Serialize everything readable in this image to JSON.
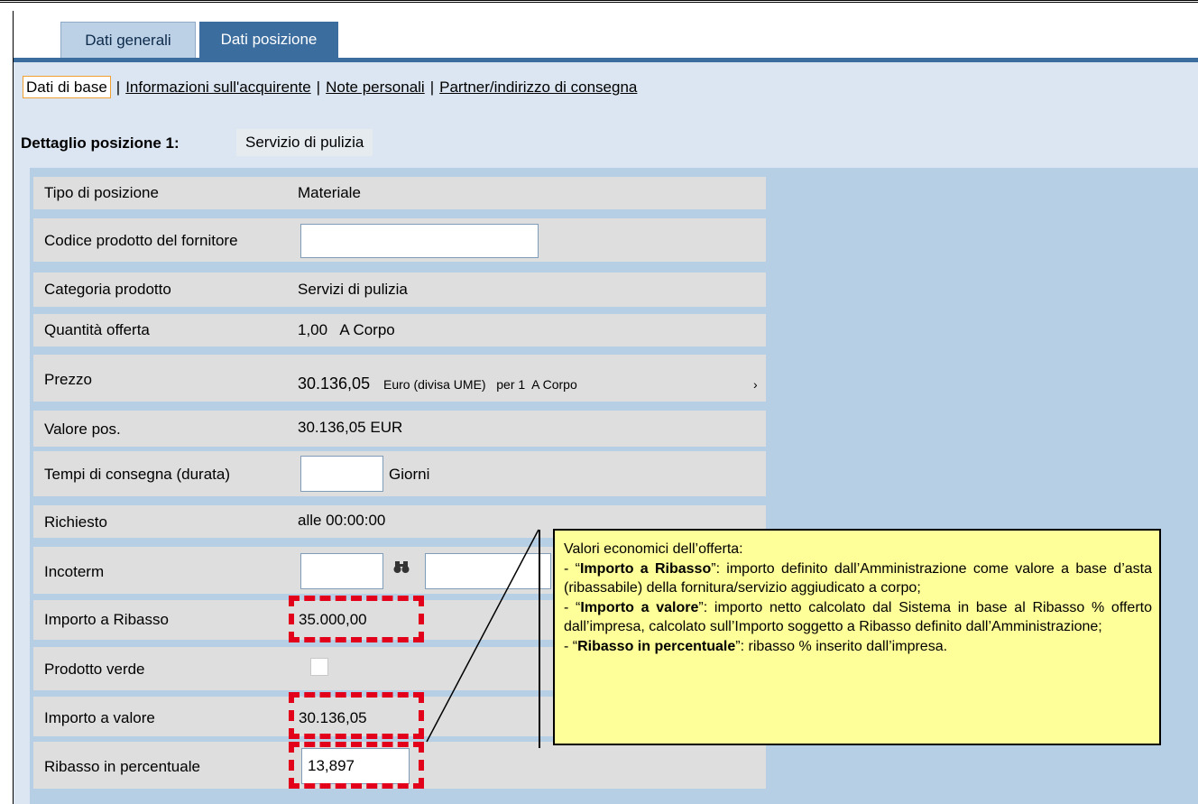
{
  "tabs": {
    "general": "Dati generali",
    "position": "Dati posizione"
  },
  "sublinks": {
    "base": "Dati di base",
    "buyer_info": "Informazioni sull'acquirente",
    "personal_notes": "Note personali",
    "partner": "Partner/indirizzo di consegna",
    "separator": "|"
  },
  "detail": {
    "label": "Dettaglio posizione 1:",
    "value": "Servizio di pulizia"
  },
  "fields": {
    "tipo_label": "Tipo di posizione",
    "tipo_value": "Materiale",
    "codice_label": "Codice prodotto del fornitore",
    "codice_value": "",
    "categoria_label": "Categoria prodotto",
    "categoria_value": "Servizi di pulizia",
    "quantita_label": "Quantità offerta",
    "quantita_value": "1,00   A Corpo",
    "prezzo_label": "Prezzo",
    "prezzo_value": "30.136,05",
    "prezzo_unit": "Euro (divisa UME)   per 1  A Corpo",
    "prezzo_arrow": "›",
    "valore_label": "Valore pos.",
    "valore_value": "30.136,05 EUR",
    "tempi_label": "Tempi di consegna (durata)",
    "tempi_value": "",
    "tempi_unit": "Giorni",
    "richiesto_label": "Richiesto",
    "richiesto_value": "alle 00:00:00",
    "incoterm_label": "Incoterm",
    "incoterm_value1": "",
    "incoterm_value2": "",
    "ribasso_imp_label": "Importo a Ribasso",
    "ribasso_imp_value": "35.000,00",
    "verde_label": "Prodotto verde",
    "valore_imp_label": "Importo a valore",
    "valore_imp_value": "30.136,05",
    "ribasso_pct_label": "Ribasso in percentuale",
    "ribasso_pct_value": "13,897"
  },
  "callout": {
    "title": "Valori economici dell’offerta:",
    "l1_prefix": "- “",
    "l1_bold": "Importo a Ribasso",
    "l1_rest": "”: importo definito dall’Amministrazione come valore a base d’asta (ribassabile) della fornitura/servizio aggiudicato a corpo;",
    "l2_prefix": "- “",
    "l2_bold": "Importo a valore",
    "l2_rest": "”: importo netto calcolato dal Sistema in base al Ribasso % offerto dall’impresa, calcolato sull’Importo soggetto a Ribasso definito dall’Amministrazione;",
    "l3_prefix": "- “",
    "l3_bold": "Ribasso in percentuale",
    "l3_rest": "”: ribasso % inserito dall’impresa."
  },
  "colors": {
    "tab_active": "#3b6d9e",
    "highlight": "#e3001b",
    "callout_bg": "#ffff99"
  }
}
